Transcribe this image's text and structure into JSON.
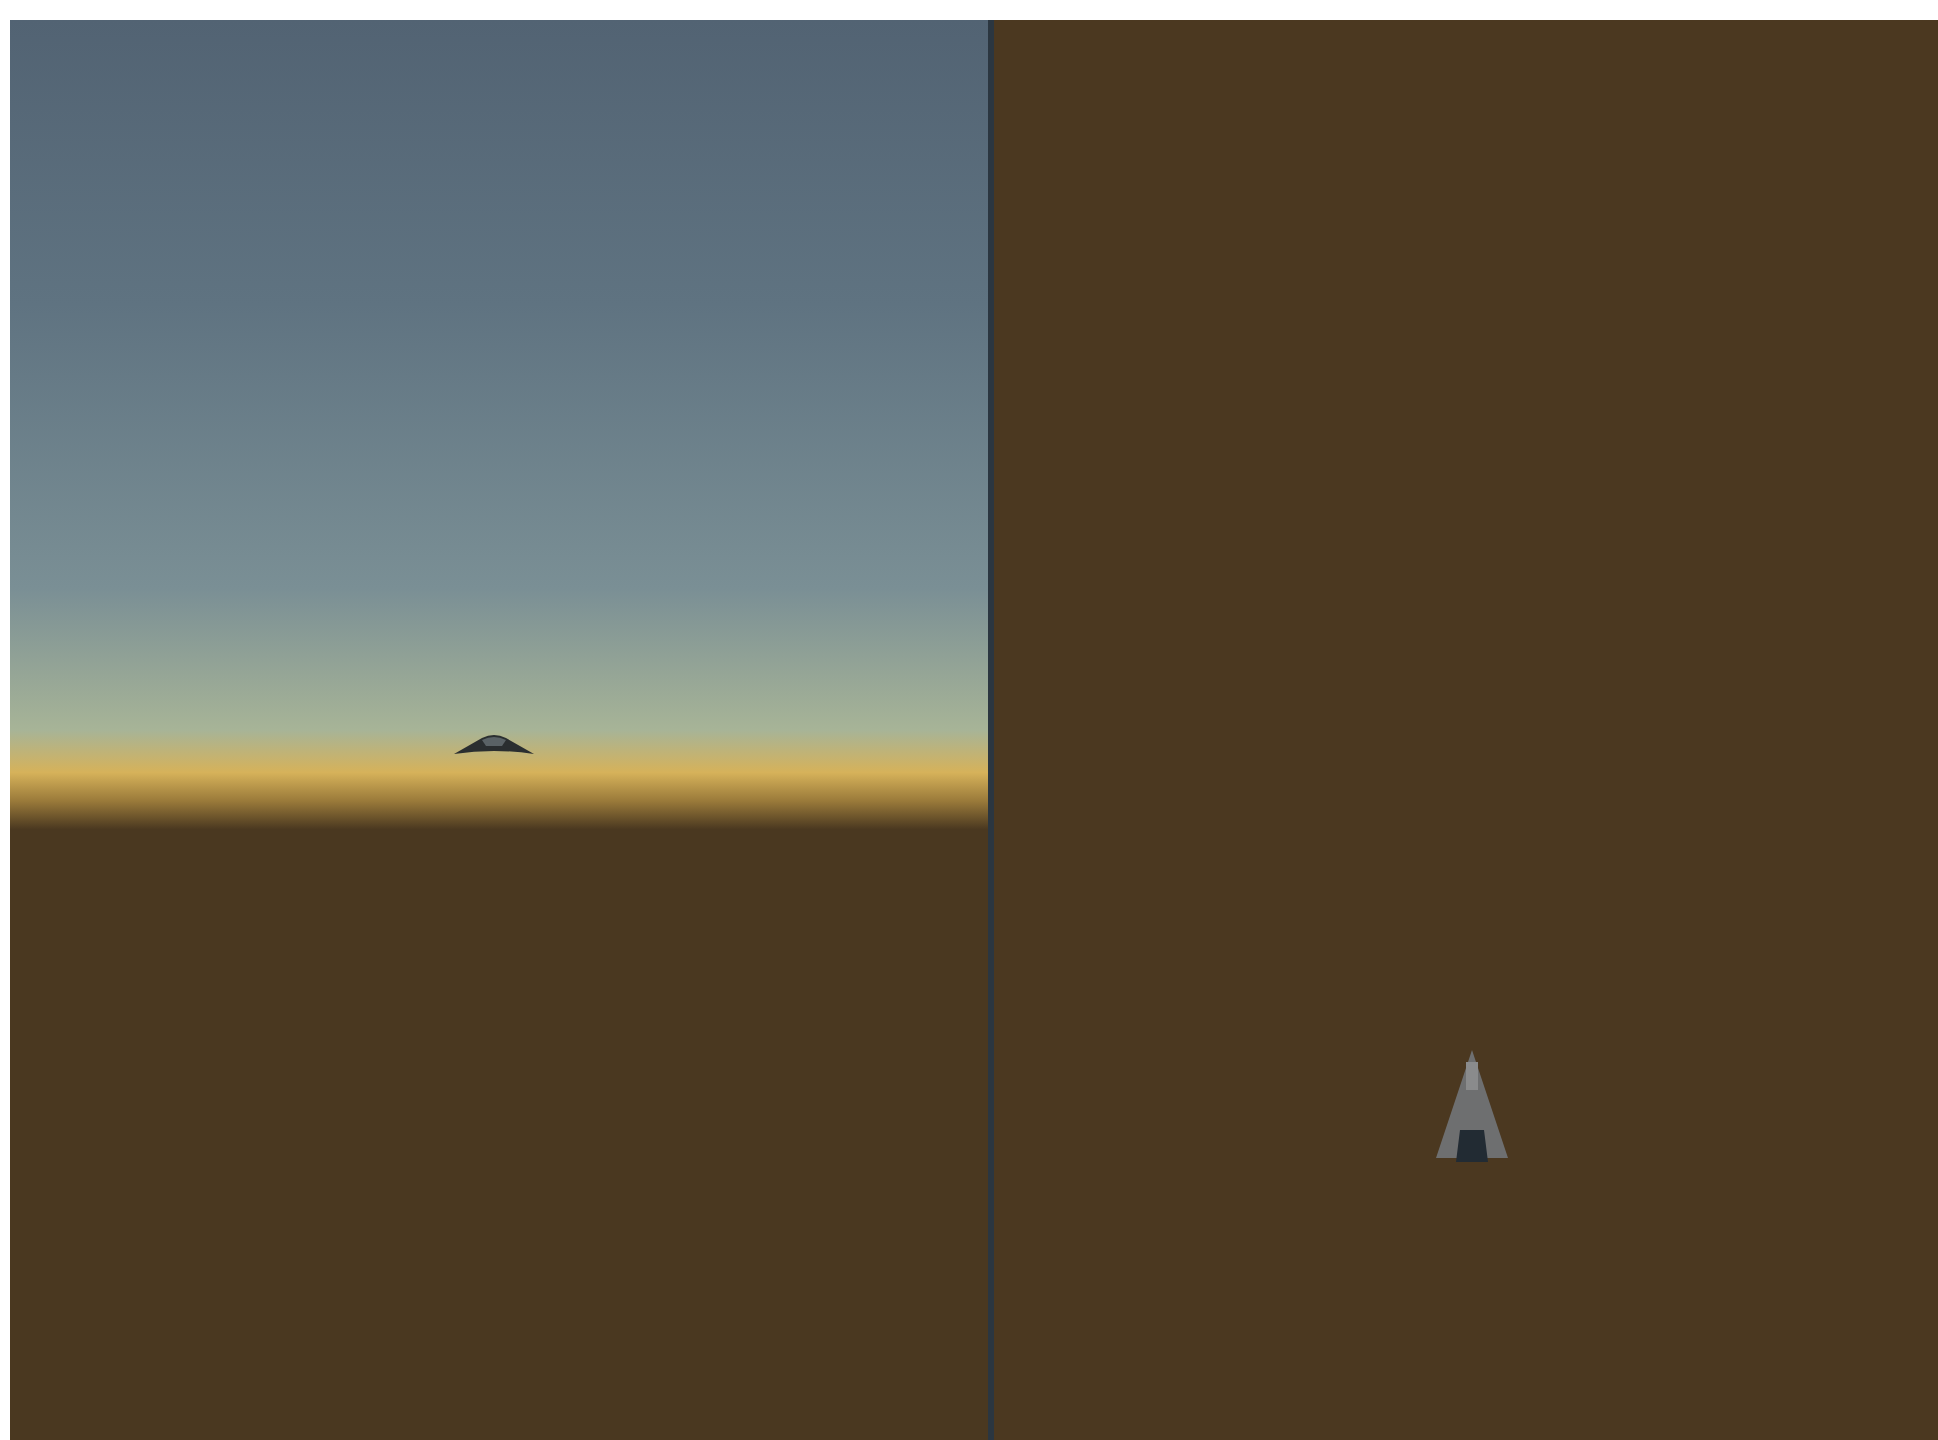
{
  "viewports": [
    {
      "kind": "horizon"
    },
    {
      "kind": "top_down"
    }
  ]
}
